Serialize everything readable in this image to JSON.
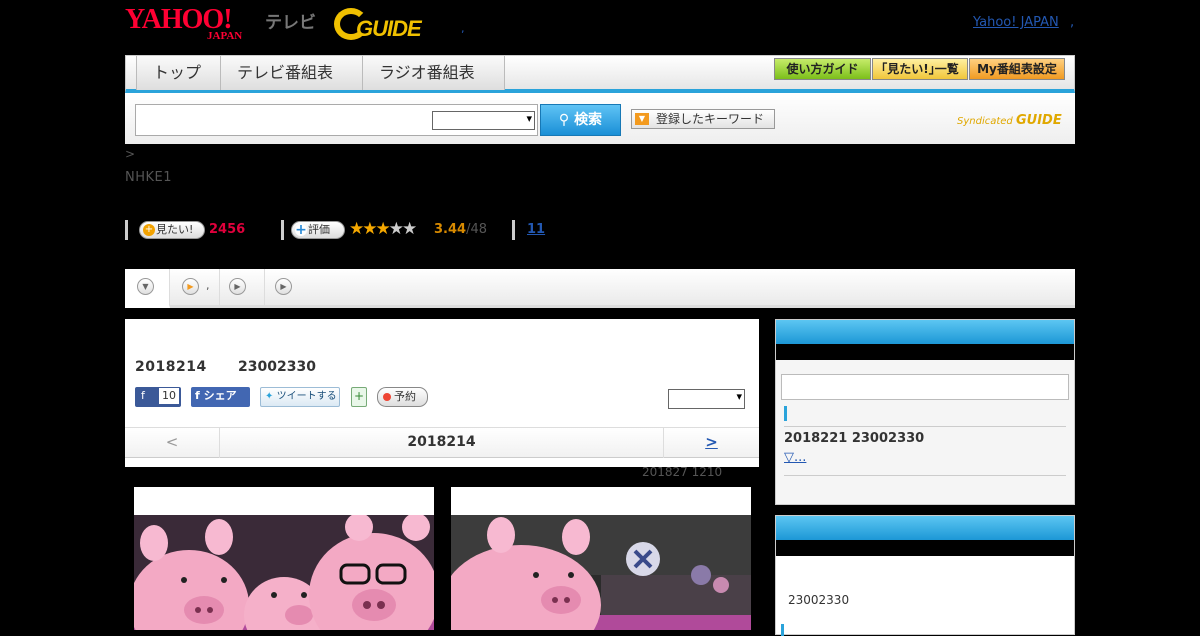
{
  "header": {
    "yahoo_logo": "YAHOO!",
    "yahoo_logo_sub": "JAPAN",
    "tv_label": "テレビ",
    "gguide_logo": "GUIDE",
    "top_dot": ",",
    "yahoo_japan_link": "Yahoo! JAPAN",
    "yahoo_japan_link_sep": ","
  },
  "nav": {
    "tabs": [
      {
        "label": "トップ"
      },
      {
        "label": "テレビ番組表"
      },
      {
        "label": "ラジオ番組表"
      }
    ],
    "right_buttons": [
      {
        "label": "使い方ガイド",
        "color": "#7cbf1a"
      },
      {
        "label": "｢見たい!｣一覧",
        "color": "#f1c63b"
      },
      {
        "label": "My番組表設定",
        "color": "#f09a22"
      }
    ]
  },
  "search": {
    "input_value": "",
    "select_value": "",
    "button_label": "検索",
    "keyword_button": "登録したキーワード",
    "syndicated_label": "Syndicated",
    "syndicated_logo": "GUIDE"
  },
  "breadcrumb": " >",
  "channel": "NHKE1",
  "stats": {
    "miru_label": "見たい!",
    "miru_count": "2456",
    "rating_label": "評価",
    "stars_filled": 3,
    "stars_total": 5,
    "score": "3.44",
    "score_total": "/48",
    "reviews_count": "11"
  },
  "subtabs": [
    {
      "label": "",
      "icon": "chevron-down-icon"
    },
    {
      "label": ",",
      "icon": "play-icon"
    },
    {
      "label": "",
      "icon": "play-icon"
    },
    {
      "label": "",
      "icon": "play-icon"
    }
  ],
  "program": {
    "date": "2018214",
    "time": "23002330",
    "share": {
      "fb_like_count": "10",
      "fb_share_label": "シェア",
      "tweet_label": "ツイートする",
      "reserve_label": "予約"
    },
    "select_value": "",
    "pager": {
      "prev": "<",
      "current": "2018214",
      "next": ">"
    },
    "updated": "201827  1210"
  },
  "sidebar": {
    "panel1": {
      "search_value": "",
      "episode": "2018221  23002330",
      "more_link": "▽...          "
    },
    "panel2": {
      "time": "23002330"
    }
  },
  "colors": {
    "accent": "#2aa3da",
    "miru": "#e0003c",
    "star": "#f5a800"
  }
}
